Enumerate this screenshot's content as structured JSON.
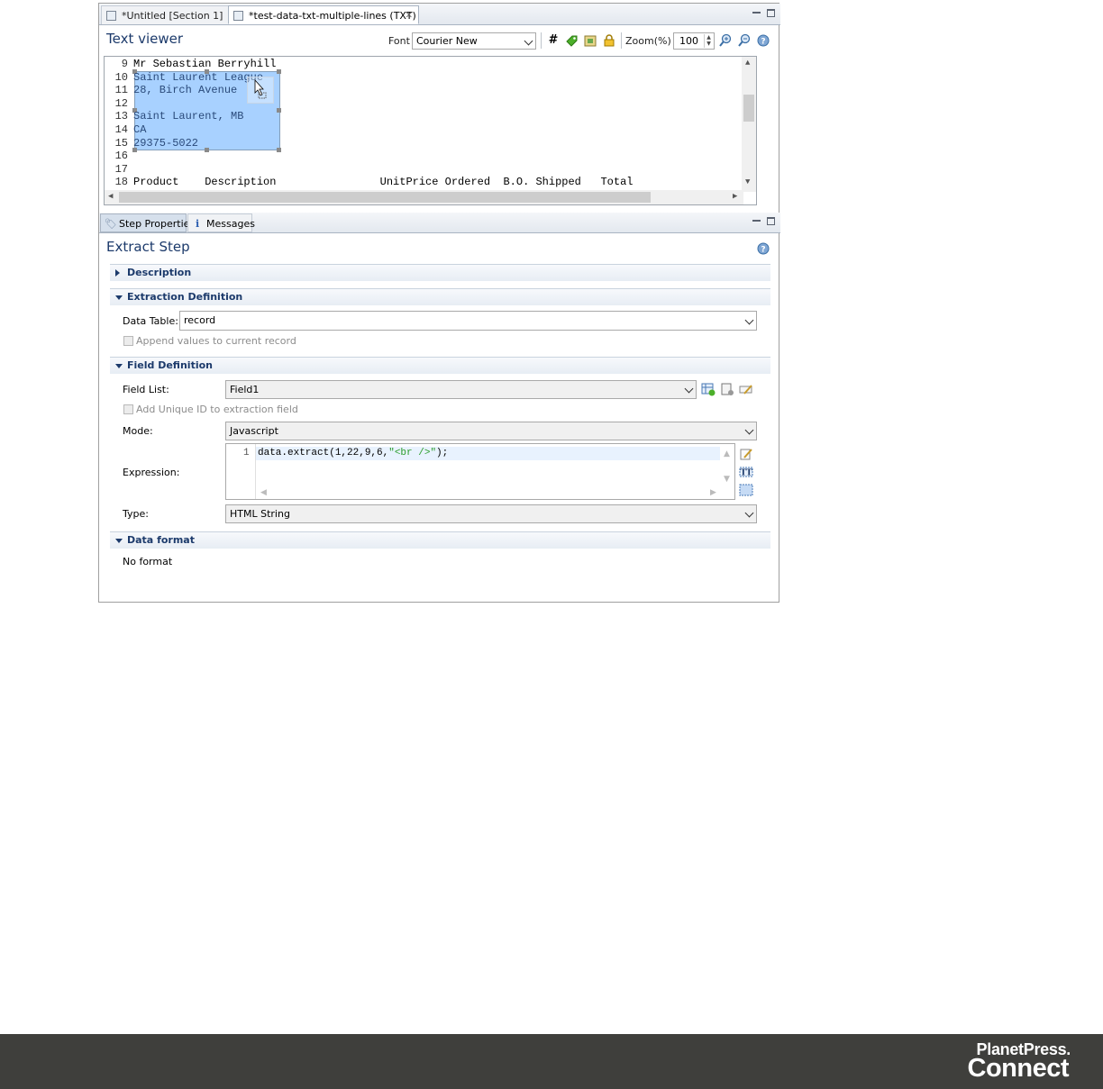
{
  "tabs": [
    {
      "label": "*Untitled [Section 1]"
    },
    {
      "label": "*test-data-txt-multiple-lines (TXT)"
    }
  ],
  "viewer": {
    "title": "Text viewer",
    "font_label": "Font",
    "font_value": "Courier New",
    "zoom_label": "Zoom(%)",
    "zoom_value": "100",
    "lines": [
      {
        "num": "9",
        "text": "Mr Sebastian Berryhill"
      },
      {
        "num": "10",
        "text": "Saint Laurent League"
      },
      {
        "num": "11",
        "text": "28, Birch Avenue"
      },
      {
        "num": "12",
        "text": ""
      },
      {
        "num": "13",
        "text": "Saint Laurent, MB"
      },
      {
        "num": "14",
        "text": "CA"
      },
      {
        "num": "15",
        "text": "29375-5022"
      },
      {
        "num": "16",
        "text": ""
      },
      {
        "num": "17",
        "text": ""
      },
      {
        "num": "18",
        "text": "Product    Description                UnitPrice Ordered  B.O. Shipped   Total"
      }
    ],
    "toolbar_icons": [
      "hash-icon",
      "tag-icon",
      "image-icon",
      "lock-icon",
      "zoom-in-icon",
      "zoom-out-icon",
      "help-icon"
    ]
  },
  "props": {
    "tab_step": "Step Properties",
    "tab_messages": "Messages",
    "title": "Extract Step",
    "sections": {
      "description": "Description",
      "extraction": "Extraction Definition",
      "field": "Field Definition",
      "format": "Data format"
    },
    "data_table_label": "Data Table:",
    "data_table_value": "record",
    "append_label": "Append values to current record",
    "field_list_label": "Field List:",
    "field_list_value": "Field1",
    "unique_id_label": "Add Unique ID to extraction field",
    "mode_label": "Mode:",
    "mode_value": "Javascript",
    "expression_label": "Expression:",
    "expression_line": "1",
    "expression_code": "data.extract(1,22,9,6,",
    "expression_string": "\"<br />\"",
    "expression_end": ");",
    "type_label": "Type:",
    "type_value": "HTML String",
    "format_value": "No format"
  },
  "footer": {
    "brand_line1": "PlanetPress.",
    "brand_line2": "Connect"
  }
}
